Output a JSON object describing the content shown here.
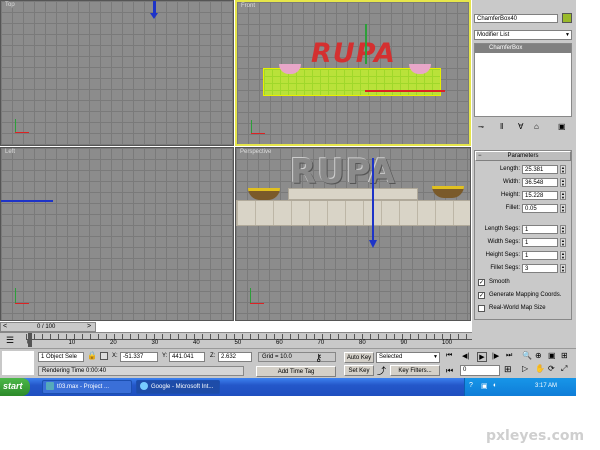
{
  "viewports": {
    "top": "Top",
    "front": "Front",
    "left": "Left",
    "perspective": "Perspective"
  },
  "scene": {
    "text_object": "RUPA"
  },
  "command_panel": {
    "object_name": "ChamferBox40",
    "object_color": "#9aba2a",
    "modifier_list": "Modifier List",
    "stack_item": "ChamferBox",
    "rollout_title": "Parameters",
    "params": [
      {
        "label": "Length:",
        "value": "25.381"
      },
      {
        "label": "Width:",
        "value": "36.548"
      },
      {
        "label": "Height:",
        "value": "15.228"
      },
      {
        "label": "Fillet:",
        "value": "0.05"
      }
    ],
    "segs": [
      {
        "label": "Length Segs:",
        "value": "1"
      },
      {
        "label": "Width Segs:",
        "value": "1"
      },
      {
        "label": "Height Segs:",
        "value": "1"
      },
      {
        "label": "Fillet Segs:",
        "value": "3"
      }
    ],
    "options": [
      {
        "label": "Smooth",
        "checked": true
      },
      {
        "label": "Generate Mapping Coords.",
        "checked": true
      },
      {
        "label": "Real-World Map Size",
        "checked": false
      }
    ]
  },
  "timeline": {
    "slider_label": "0 / 100",
    "ticks": [
      "0",
      "10",
      "20",
      "30",
      "40",
      "50",
      "60",
      "70",
      "80",
      "90",
      "100"
    ]
  },
  "status": {
    "selection": "1 Object Sele",
    "x_label": "X:",
    "x_value": "-51.337",
    "y_label": "Y:",
    "y_value": "441.041",
    "z_label": "Z:",
    "z_value": "2.632",
    "grid": "Grid = 10.0",
    "rendering_time": "Rendering Time  0:00:40",
    "add_time_tag": "Add Time Tag",
    "auto_key": "Auto Key",
    "set_key": "Set Key",
    "key_mode": "Selected",
    "key_filters": "Key Filters...",
    "frame": "0"
  },
  "taskbar": {
    "start": "start",
    "tasks": [
      "t03.max - Project ...",
      "Google - Microsoft Int..."
    ],
    "clock": "3:17 AM"
  },
  "watermark": "pxleyes.com"
}
